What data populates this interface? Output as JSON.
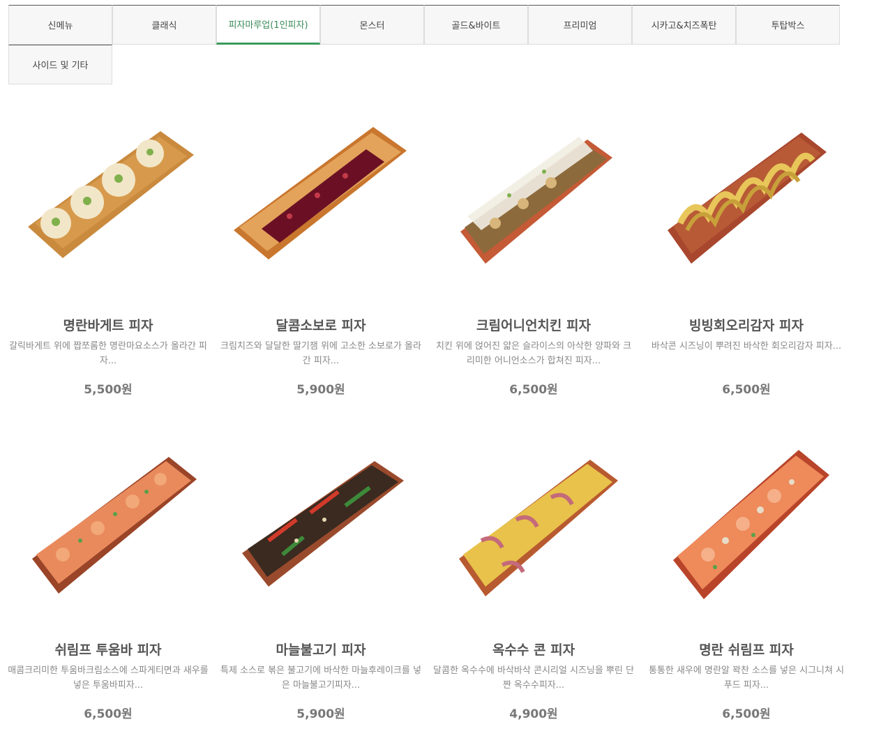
{
  "tabs": [
    {
      "label": "신메뉴",
      "active": false
    },
    {
      "label": "클래식",
      "active": false
    },
    {
      "label": "피자마루업(1인피자)",
      "active": true
    },
    {
      "label": "몬스터",
      "active": false
    },
    {
      "label": "골드&바이트",
      "active": false
    },
    {
      "label": "프리미엄",
      "active": false
    },
    {
      "label": "시카고&치즈폭탄",
      "active": false
    },
    {
      "label": "투탑박스",
      "active": false
    },
    {
      "label": "사이드 및 기타",
      "active": false
    }
  ],
  "products": [
    {
      "name": "명란바게트 피자",
      "desc": "갈릭바게트 위에 짭쪼롬한 명란마요소스가 올라간 피자...",
      "price": "5,500원",
      "crust": "#c98a3e",
      "topping": "#f2e6c8",
      "accent": "#7fb04c",
      "icon": "baguette-pizza"
    },
    {
      "name": "달콤소보로 피자",
      "desc": "크림치즈와 달달한 딸기잼 위에 고소한 소보로가 올라간 피자...",
      "price": "5,900원",
      "crust": "#d8893e",
      "topping": "#6b1024",
      "accent": "#e3a35a",
      "icon": "soboro-pizza"
    },
    {
      "name": "크림어니언치킨 피자",
      "desc": "치킨 위에 얹어진 얇은 슬라이스의 아삭한 양파와 크리미한 어니언소스가 합쳐진 피자...",
      "price": "6,500원",
      "crust": "#c45a36",
      "topping": "#f1ede2",
      "accent": "#8d6a3c",
      "icon": "onion-chicken-pizza"
    },
    {
      "name": "빙빙회오리감자 피자",
      "desc": "바삭콘 시즈닝이 뿌려진 바삭한 회오리감자 피자...",
      "price": "6,500원",
      "crust": "#a8472d",
      "topping": "#c8a03a",
      "accent": "#e8c65a",
      "icon": "potato-pizza"
    },
    {
      "name": "쉬림프 투움바 피자",
      "desc": "매콤크리미한 투움바크림소스에 스파게티면과 새우를 넣은 투움바피자...",
      "price": "6,500원",
      "crust": "#c75a34",
      "topping": "#e98a5c",
      "accent": "#5aa04a",
      "icon": "shrimp-toowoomba-pizza"
    },
    {
      "name": "마늘불고기 피자",
      "desc": "특제 소스로 볶은 불고기에 바삭한 마늘후레이크를 넣은 마늘불고기피자...",
      "price": "5,900원",
      "crust": "#9a4a2c",
      "topping": "#3a2a20",
      "accent": "#d23a2a",
      "icon": "garlic-bulgogi-pizza"
    },
    {
      "name": "옥수수 콘 피자",
      "desc": "달콤한 옥수수에 바삭바삭 콘시리얼 시즈닝을 뿌린 단짠 옥수수피자...",
      "price": "4,900원",
      "crust": "#b85a30",
      "topping": "#e8c24a",
      "accent": "#c46a7a",
      "icon": "corn-pizza"
    },
    {
      "name": "명란 쉬림프 피자",
      "desc": "통통한 새우에 명란알 꽉찬 소스를 넣은 시그니쳐 시푸드 피자...",
      "price": "6,500원",
      "crust": "#d6583a",
      "topping": "#ef8a5a",
      "accent": "#e8dcc8",
      "icon": "myeongran-shrimp-pizza"
    }
  ]
}
